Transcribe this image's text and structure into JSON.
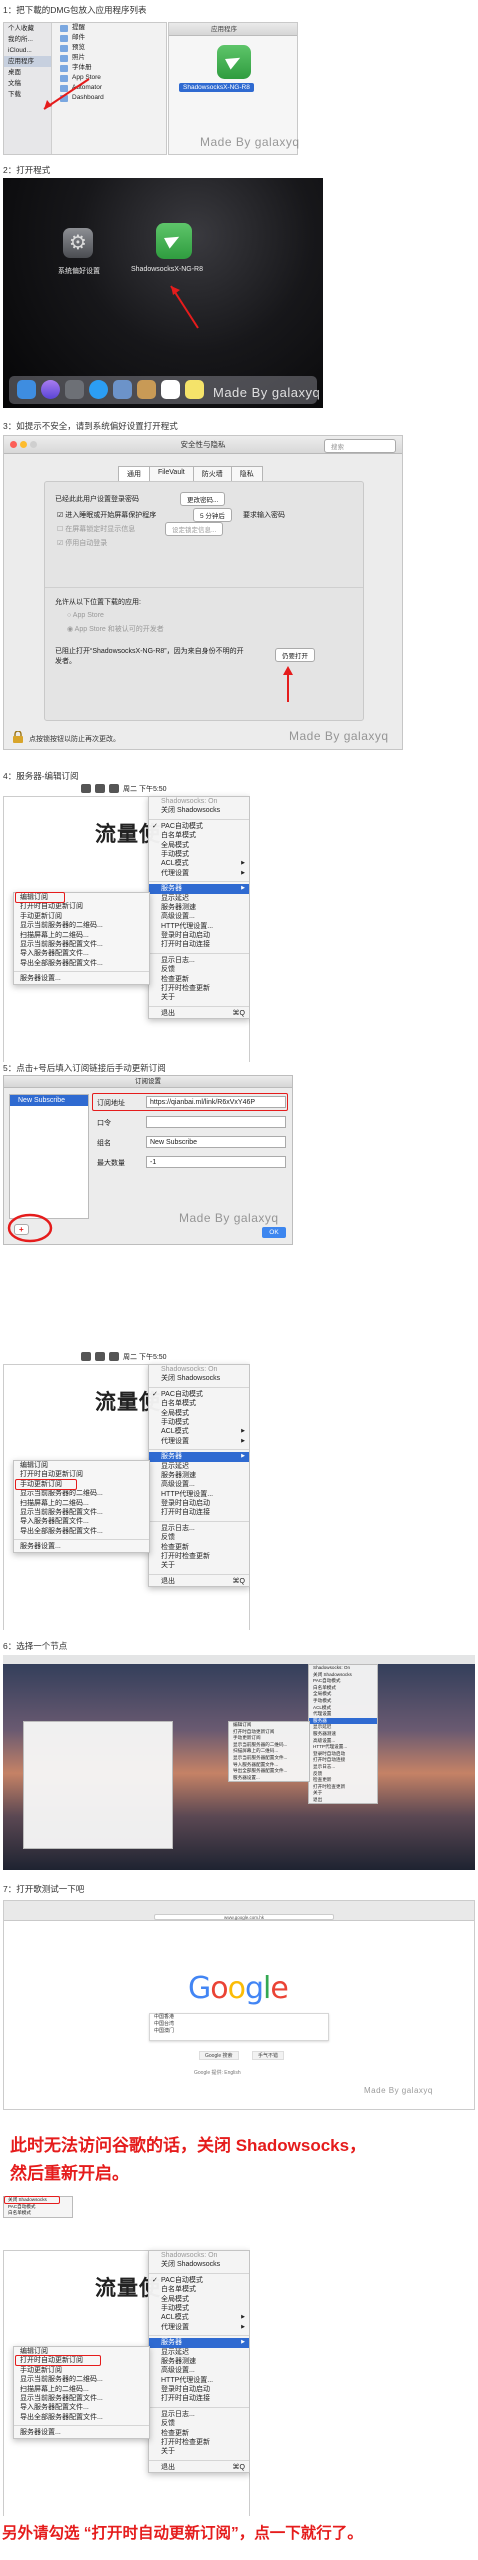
{
  "steps": {
    "s1": "1：把下載的DMG包放入应用程序列表",
    "s2": "2：打开程式",
    "s3": "3：如提示不安全，请到系统偏好设置打开程式",
    "s4": "4：服务器-编辑订阅",
    "s5": "5：点击+号后填入订阅链接后手动更新订阅",
    "s6": "6：选择一个节点",
    "s7": "7：打开歌测试一下吧"
  },
  "watermark": "Made By galaxyq",
  "finder": {
    "sidebar": [
      "个人收藏",
      "我的所...",
      "iCloud...",
      "应用程序",
      "桌面",
      "文稿",
      "下载"
    ],
    "files": [
      "提醒",
      "邮件",
      "预览",
      "照片",
      "字体册",
      "App Store",
      "Automator",
      "Dashboard"
    ],
    "window_title": "应用程序",
    "dmg_app": "ShadowsocksX-NG-R8"
  },
  "launch": {
    "sys_prefs": "系统偏好设置",
    "app": "ShadowsocksX-NG-R8"
  },
  "prefs": {
    "title": "安全性与隐私",
    "search": "搜索",
    "tabs": [
      "通用",
      "FileVault",
      "防火墙",
      "隐私"
    ],
    "password_set": "已经此此用户设置登录密码",
    "change_password": "更改密码...",
    "require_pw": "进入睡眠或开始屏幕保护程序",
    "require_after": "5 分钟后",
    "require_label": "要求输入密码",
    "show_msg": "在屏幕锁定时显示信息",
    "set_lock_msg": "设定锁定信息...",
    "auto_login": "停用自动登录",
    "allow_from": "允许从以下位置下载的应用:",
    "app_store": "App Store",
    "app_store_dev": "App Store 和被认可的开发者",
    "blocked_msg": "已阻止打开“ShadowsocksX-NG-R8”，因为来自身份不明的开发者。",
    "open_anyway": "仍要打开",
    "lock_note": "点按锁按钮以防止再次更改。"
  },
  "menubar": {
    "clock": "周二 下午5:50"
  },
  "main_menu": {
    "items": [
      "Shadowsocks: On",
      "关闭 Shadowsocks",
      "PAC自动模式",
      "白名单模式",
      "全局模式",
      "手动模式",
      "ACL模式",
      "代理设置",
      "服务器",
      "显示延迟",
      "服务器测速",
      "高级设置...",
      "HTTP代理设置...",
      "登录时自动启动",
      "打开时自动连接",
      "显示日志...",
      "反馈",
      "检查更新",
      "打开时检查更新",
      "关于",
      "退出"
    ],
    "quit_shortcut": "⌘Q"
  },
  "flow_title": "流量使",
  "sub_menu": [
    "编辑订阅",
    "打开时自动更新订阅",
    "手动更新订阅",
    "显示当前服务器的二维码...",
    "扫描屏幕上的二维码...",
    "显示当前服务器配置文件...",
    "导入服务器配置文件...",
    "导出全部服务器配置文件...",
    "服务器设置..."
  ],
  "sub_dialog": {
    "title": "订阅设置",
    "list_item": "New Subscribe",
    "url_label": "订阅地址",
    "url_value": "https://qianbai.ml/link/R6xVxY46P",
    "token_label": "口令",
    "group_label": "组名",
    "group_value": "New Subscribe",
    "max_label": "最大数量",
    "max_value": "-1",
    "ok": "OK",
    "add_icon": "+"
  },
  "google": {
    "search_lines": [
      "中国香港",
      "中国台湾",
      "中国澳门"
    ],
    "btn1": "Google 搜索",
    "btn2": "手气不错",
    "langs": "Google 提供: English",
    "url": "www.google.com.hk"
  },
  "notes": {
    "line1": "此时无法访问谷歌的话，关闭 Shadowsocks，",
    "line2": "然后重新开启。",
    "mini_menu": [
      "关闭 Shadowsocks",
      "PAC自动模式",
      "白名单模式"
    ],
    "final": "另外请勾选 “打开时自动更新订阅”，点一下就行了。"
  },
  "colors": {
    "highlight_blue": "#2f6ad1",
    "annotation_red": "#e51c1c",
    "ss_green": "#3aae4b"
  }
}
